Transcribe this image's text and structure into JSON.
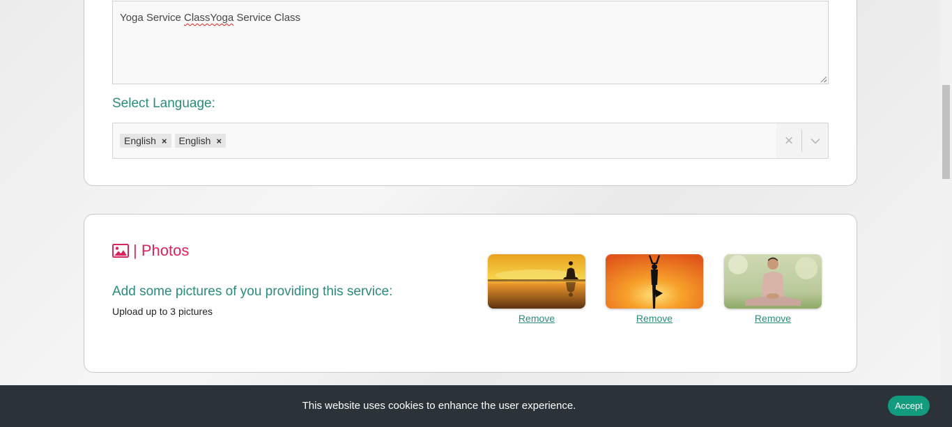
{
  "service": {
    "description_value_parts": [
      "Yoga Service ",
      "ClassYoga",
      " Service Class"
    ]
  },
  "language": {
    "label": "Select Language:",
    "selected": [
      {
        "label": "English",
        "remove": "×"
      },
      {
        "label": "English",
        "remove": "×"
      }
    ],
    "clear_glyph": "×"
  },
  "photos": {
    "title": "| Photos",
    "subtitle": "Add some pictures of you providing this service:",
    "hint": "Upload up to 3 pictures",
    "items": [
      {
        "remove_label": "Remove"
      },
      {
        "remove_label": "Remove"
      },
      {
        "remove_label": "Remove"
      }
    ]
  },
  "cookie": {
    "message": "This website uses cookies to enhance the user experience.",
    "accept_label": "Accept"
  },
  "colors": {
    "accent_teal": "#2a8a7c",
    "accent_pink": "#d8245a",
    "button_green": "#139b7f",
    "banner_bg": "#2b3338"
  },
  "icons": {
    "photos": "image-icon",
    "clear": "clear-icon",
    "dropdown": "chevron-down-icon"
  }
}
